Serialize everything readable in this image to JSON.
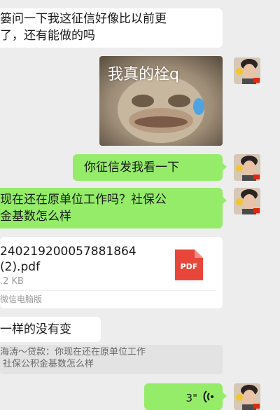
{
  "messages": {
    "m1_line1": "篓问一下我这征信好像比以前更",
    "m1_line2": "了，还有能做的吗",
    "sticker_text": "我真的栓q",
    "m2": "你征信发我看一下",
    "m3_line1": "现在还在原单位工作吗？社保公",
    "m3_line2": "金基数怎么样",
    "file": {
      "name_line1": "240219200057881864",
      "name_line2": "(2).pdf",
      "size": ".2 KB",
      "source": "微信电脑版",
      "type_label": "PDF"
    },
    "m4": "一样的没有变",
    "quote_line1": "海涛～贷款：你现在还在原单位工作",
    "quote_line2": "社保公积金基数怎么样",
    "voice_duration": "3\""
  },
  "colors": {
    "background": "#ededed",
    "incoming_bubble": "#ffffff",
    "outgoing_bubble": "#95ec69",
    "pdf_red": "#e8463a"
  },
  "icons": {
    "voice": "voice-wave-icon",
    "file": "pdf-file-icon",
    "avatar": "avatar"
  }
}
